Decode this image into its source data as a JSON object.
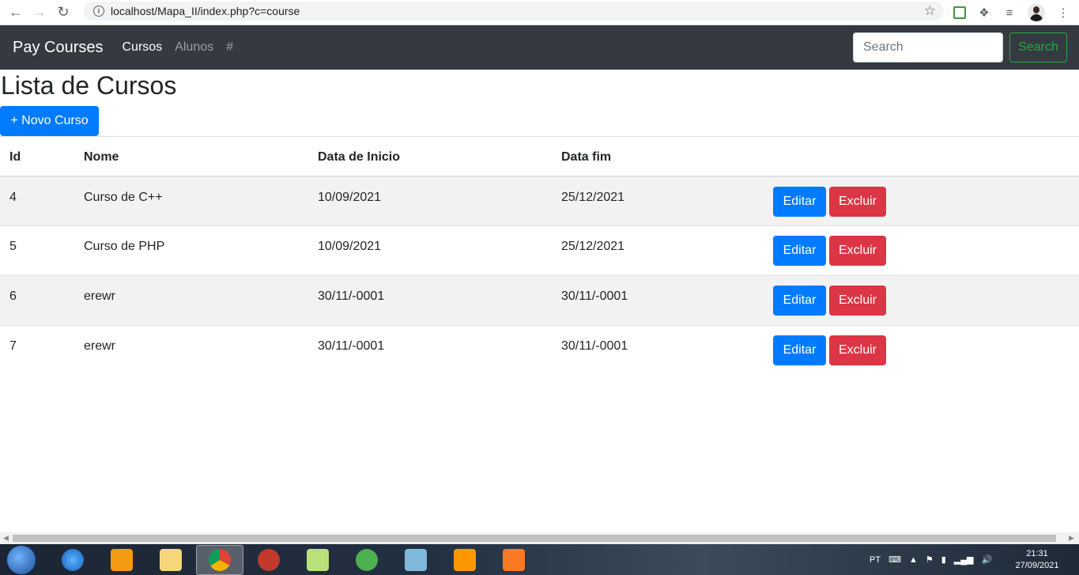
{
  "browser": {
    "url": "localhost/Mapa_II/index.php?c=course"
  },
  "navbar": {
    "brand": "Pay Courses",
    "links": [
      {
        "label": "Cursos",
        "active": true
      },
      {
        "label": "Alunos",
        "active": false
      },
      {
        "label": "#",
        "active": false
      }
    ],
    "search_placeholder": "Search",
    "search_button": "Search"
  },
  "main": {
    "title": "Lista de Cursos",
    "new_button": "+ Novo Curso",
    "table": {
      "headers": [
        "Id",
        "Nome",
        "Data de Inicio",
        "Data fim",
        ""
      ],
      "rows": [
        {
          "id": "4",
          "nome": "Curso de C++",
          "inicio": "10/09/2021",
          "fim": "25/12/2021"
        },
        {
          "id": "5",
          "nome": "Curso de PHP",
          "inicio": "10/09/2021",
          "fim": "25/12/2021"
        },
        {
          "id": "6",
          "nome": "erewr",
          "inicio": "30/11/-0001",
          "fim": "30/11/-0001"
        },
        {
          "id": "7",
          "nome": "erewr",
          "inicio": "30/11/-0001",
          "fim": "30/11/-0001"
        }
      ],
      "edit_label": "Editar",
      "delete_label": "Excluir"
    }
  },
  "taskbar": {
    "language": "PT",
    "time": "21:31",
    "date": "27/09/2021"
  },
  "colors": {
    "navbar_bg": "#343a40",
    "primary": "#007bff",
    "danger": "#dc3545",
    "success": "#28a745"
  }
}
